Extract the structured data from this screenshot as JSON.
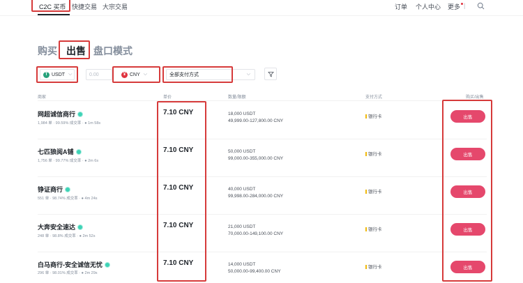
{
  "nav": {
    "items": [
      "C2C 买币",
      "快捷交易",
      "大宗交易"
    ],
    "right": [
      "订单",
      "个人中心",
      "更多"
    ]
  },
  "tabs": [
    "购买",
    "出售",
    "盘口模式"
  ],
  "filters": {
    "coin": "USDT",
    "amount_placeholder": "0.00",
    "currency": "CNY",
    "payment": "全部支付方式"
  },
  "table": {
    "headers": [
      "商家",
      "单价",
      "数量/限额",
      "支付方式",
      "购买/出售"
    ],
    "rows": [
      {
        "merchant": "网超诚信商行",
        "stats": "1,984 单 · 99.59% 成交率 · ● 1m 58s",
        "price": "7.10 CNY",
        "qty": "18,000 USDT",
        "limit": "49,999.00-127,800.00 CNY",
        "payment": "银行卡",
        "action": "出售"
      },
      {
        "merchant": "七匹狼阅A铺",
        "stats": "1,756 单 · 99.77% 成交率 · ● 2m 6s",
        "price": "7.10 CNY",
        "qty": "50,000 USDT",
        "limit": "99,000.00-355,000.00 CNY",
        "payment": "银行卡",
        "action": "出售"
      },
      {
        "merchant": "铮证商行",
        "stats": "551 单 · 98.74% 成交率 · ● 4m 24s",
        "price": "7.10 CNY",
        "qty": "40,000 USDT",
        "limit": "99,998.00-284,000.00 CNY",
        "payment": "银行卡",
        "action": "出售"
      },
      {
        "merchant": "大奔安全速达",
        "stats": "248 单 · 98.8% 成交率 · ● 2m 52s",
        "price": "7.10 CNY",
        "qty": "21,000 USDT",
        "limit": "70,000.00-149,100.00 CNY",
        "payment": "银行卡",
        "action": "出售"
      },
      {
        "merchant": "白马商行-安全诚信无忧",
        "stats": "296 单 · 98.01% 成交率 · ● 2m 29s",
        "price": "7.10 CNY",
        "qty": "14,000 USDT",
        "limit": "50,000.00-99,400.00 CNY",
        "payment": "银行卡",
        "action": "出售"
      }
    ]
  },
  "colors": {
    "accent_sell": "#e5486c",
    "annotation": "#d63a3a",
    "usdt": "#26a17b",
    "cny": "#e0333f"
  }
}
